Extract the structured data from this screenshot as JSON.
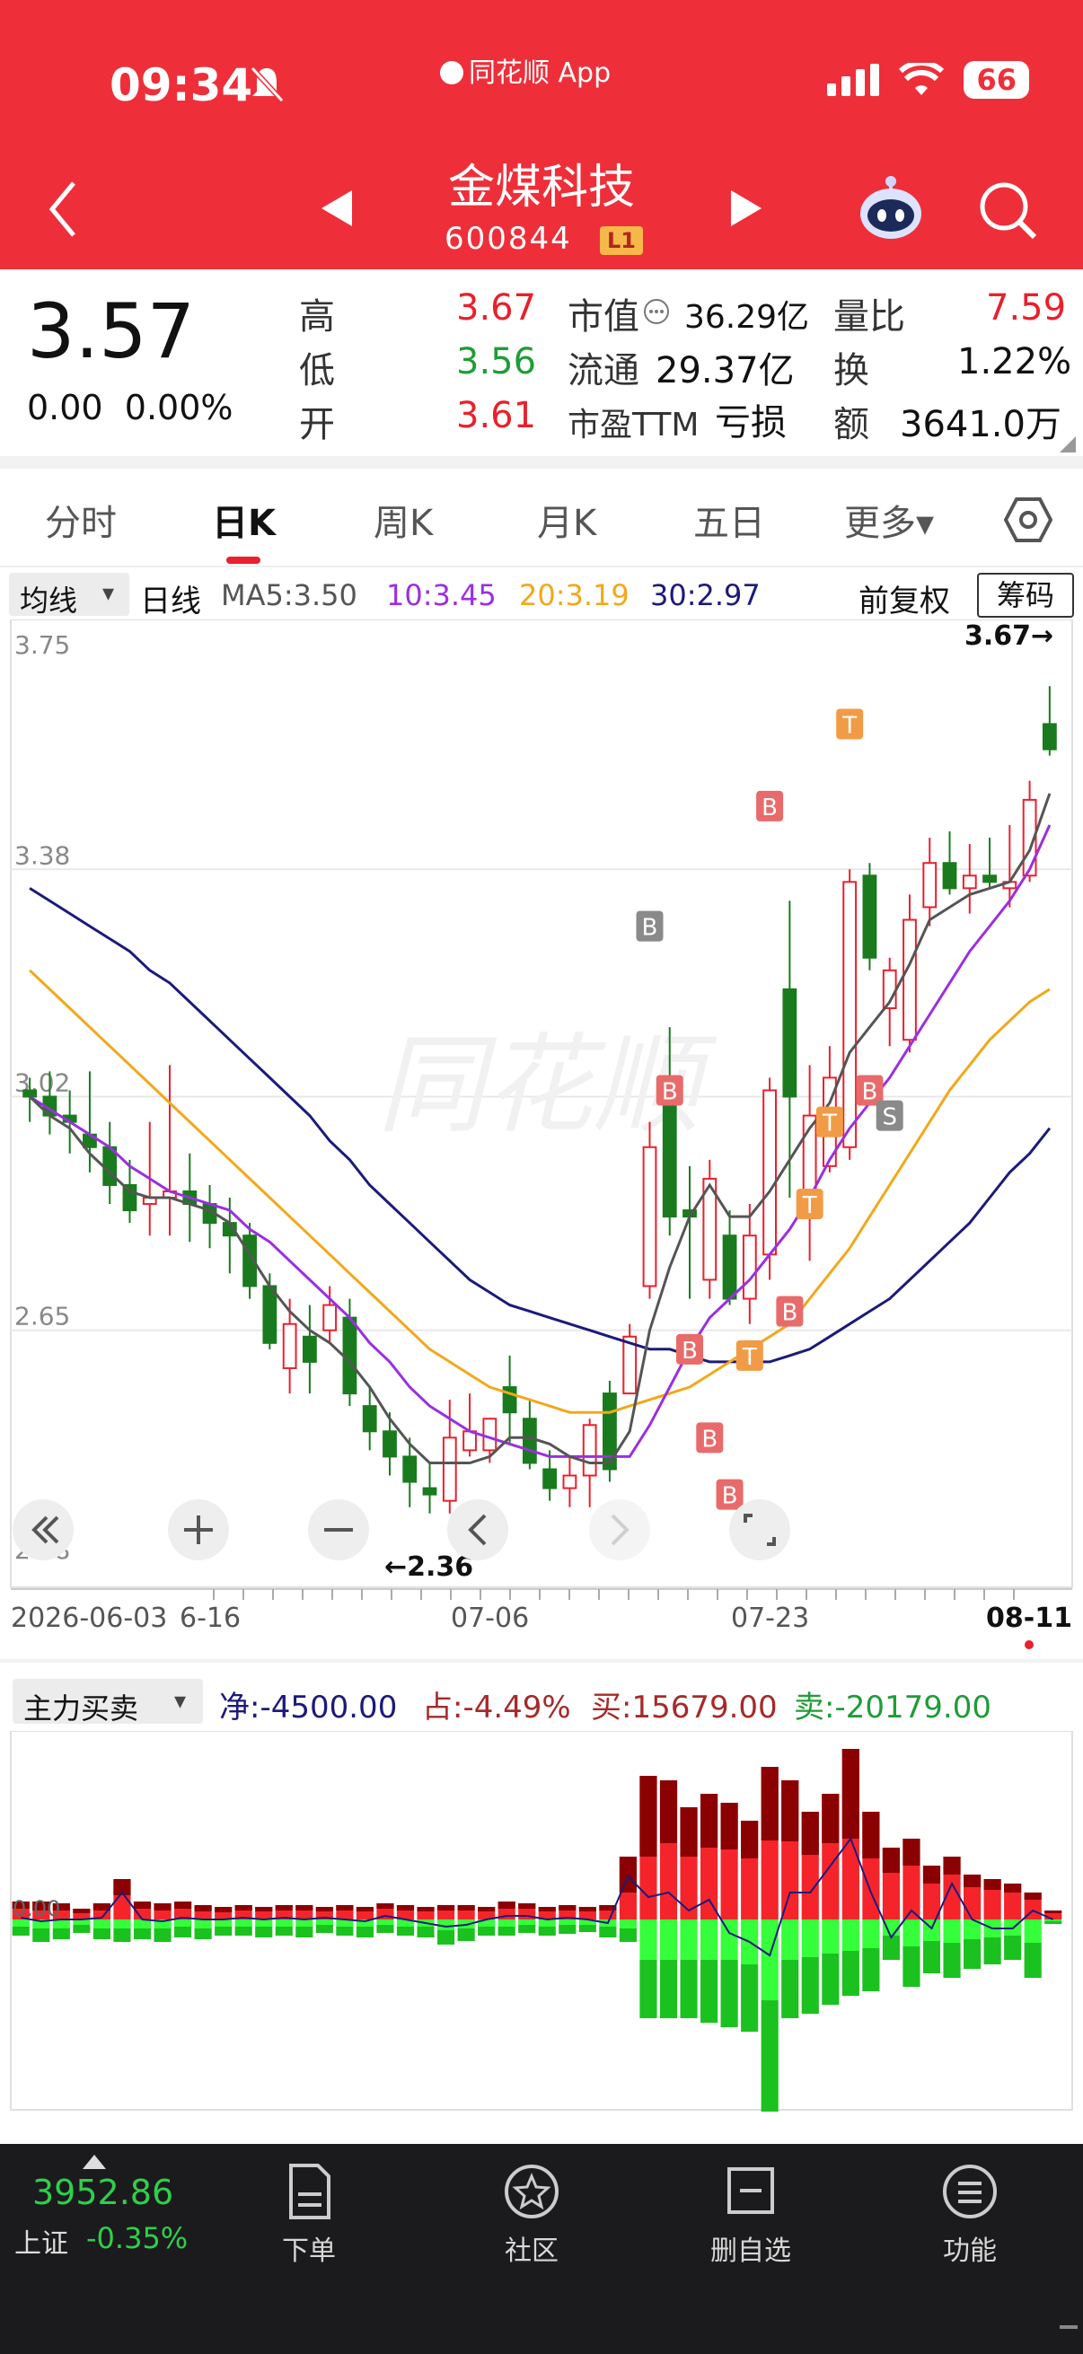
{
  "status_bar": {
    "time": "09:34",
    "app_label": "同花顺 App",
    "battery": "66"
  },
  "nav": {
    "title": "金煤科技",
    "code": "600844",
    "level_badge": "L1"
  },
  "quote": {
    "price": "3.57",
    "change": "0.00",
    "change_pct": "0.00%",
    "high_label": "高",
    "high": "3.67",
    "low_label": "低",
    "low": "3.56",
    "open_label": "开",
    "open": "3.61",
    "mcap_label": "市值",
    "mcap": "36.29亿",
    "float_label": "流通",
    "float": "29.37亿",
    "pe_label": "市盈TTM",
    "pe": "亏损",
    "vol_ratio_label": "量比",
    "vol_ratio": "7.59",
    "turnover_label": "换",
    "turnover": "1.22%",
    "amount_label": "额",
    "amount": "3641.0万"
  },
  "tabs": [
    "分时",
    "日K",
    "周K",
    "月K",
    "五日",
    "更多▾"
  ],
  "active_tab": "日K",
  "indicator_bar": {
    "selector": "均线",
    "period": "日线",
    "ma5": "MA5:3.50",
    "ma10": "10:3.45",
    "ma20": "20:3.19",
    "ma30": "30:2.97",
    "adjust": "前复权",
    "chips": "筹码"
  },
  "colors": {
    "header": "#ee2f3a",
    "up": "#e9202d",
    "down": "#1a7a1e",
    "ma5": "#555555",
    "ma10": "#9b2fe0",
    "ma20": "#f2a81b",
    "ma30": "#1c1a7a"
  },
  "chart_data": [
    {
      "type": "candlestick",
      "y_axis_labels": [
        "3.75",
        "3.38",
        "3.02",
        "2.65",
        "2.28"
      ],
      "ylim": [
        2.28,
        3.75
      ],
      "x_axis_labels": [
        "2026-06-03",
        "6-16",
        "07-06",
        "07-23",
        "08-11"
      ],
      "high_marker": "3.67→",
      "low_marker": "←2.36",
      "candles": [
        {
          "o": 3.03,
          "h": 3.05,
          "l": 2.98,
          "c": 3.02
        },
        {
          "o": 3.02,
          "h": 3.06,
          "l": 2.96,
          "c": 2.99
        },
        {
          "o": 2.99,
          "h": 3.03,
          "l": 2.93,
          "c": 2.98
        },
        {
          "o": 2.96,
          "h": 3.06,
          "l": 2.9,
          "c": 2.94
        },
        {
          "o": 2.94,
          "h": 2.98,
          "l": 2.85,
          "c": 2.88
        },
        {
          "o": 2.88,
          "h": 2.92,
          "l": 2.82,
          "c": 2.84
        },
        {
          "o": 2.85,
          "h": 2.98,
          "l": 2.8,
          "c": 2.86
        },
        {
          "o": 2.86,
          "h": 3.07,
          "l": 2.8,
          "c": 2.87
        },
        {
          "o": 2.87,
          "h": 2.93,
          "l": 2.79,
          "c": 2.85
        },
        {
          "o": 2.85,
          "h": 2.88,
          "l": 2.78,
          "c": 2.82
        },
        {
          "o": 2.82,
          "h": 2.86,
          "l": 2.74,
          "c": 2.8
        },
        {
          "o": 2.8,
          "h": 2.82,
          "l": 2.7,
          "c": 2.72
        },
        {
          "o": 2.72,
          "h": 2.74,
          "l": 2.62,
          "c": 2.63
        },
        {
          "o": 2.59,
          "h": 2.7,
          "l": 2.55,
          "c": 2.66
        },
        {
          "o": 2.64,
          "h": 2.69,
          "l": 2.55,
          "c": 2.6
        },
        {
          "o": 2.65,
          "h": 2.72,
          "l": 2.63,
          "c": 2.69
        },
        {
          "o": 2.67,
          "h": 2.7,
          "l": 2.53,
          "c": 2.55
        },
        {
          "o": 2.53,
          "h": 2.56,
          "l": 2.46,
          "c": 2.49
        },
        {
          "o": 2.49,
          "h": 2.52,
          "l": 2.42,
          "c": 2.45
        },
        {
          "o": 2.45,
          "h": 2.48,
          "l": 2.37,
          "c": 2.41
        },
        {
          "o": 2.4,
          "h": 2.44,
          "l": 2.36,
          "c": 2.39
        },
        {
          "o": 2.38,
          "h": 2.54,
          "l": 2.36,
          "c": 2.48
        },
        {
          "o": 2.46,
          "h": 2.55,
          "l": 2.45,
          "c": 2.49
        },
        {
          "o": 2.46,
          "h": 2.51,
          "l": 2.44,
          "c": 2.51
        },
        {
          "o": 2.56,
          "h": 2.61,
          "l": 2.47,
          "c": 2.52
        },
        {
          "o": 2.51,
          "h": 2.54,
          "l": 2.43,
          "c": 2.44
        },
        {
          "o": 2.43,
          "h": 2.46,
          "l": 2.38,
          "c": 2.4
        },
        {
          "o": 2.4,
          "h": 2.45,
          "l": 2.37,
          "c": 2.42
        },
        {
          "o": 2.42,
          "h": 2.51,
          "l": 2.37,
          "c": 2.5
        },
        {
          "o": 2.55,
          "h": 2.57,
          "l": 2.41,
          "c": 2.43
        },
        {
          "o": 2.55,
          "h": 2.66,
          "l": 2.55,
          "c": 2.64
        },
        {
          "o": 2.72,
          "h": 2.98,
          "l": 2.7,
          "c": 2.94
        },
        {
          "o": 3.05,
          "h": 3.13,
          "l": 2.8,
          "c": 2.83
        },
        {
          "o": 2.84,
          "h": 2.91,
          "l": 2.7,
          "c": 2.83
        },
        {
          "o": 2.73,
          "h": 2.92,
          "l": 2.7,
          "c": 2.89
        },
        {
          "o": 2.8,
          "h": 2.84,
          "l": 2.69,
          "c": 2.7
        },
        {
          "o": 2.7,
          "h": 2.85,
          "l": 2.66,
          "c": 2.8
        },
        {
          "o": 2.77,
          "h": 3.05,
          "l": 2.73,
          "c": 3.03
        },
        {
          "o": 3.19,
          "h": 3.33,
          "l": 2.86,
          "c": 3.02
        },
        {
          "o": 2.84,
          "h": 3.07,
          "l": 2.76,
          "c": 2.99
        },
        {
          "o": 2.91,
          "h": 3.1,
          "l": 2.9,
          "c": 3.05
        },
        {
          "o": 2.94,
          "h": 3.38,
          "l": 2.92,
          "c": 3.36
        },
        {
          "o": 3.37,
          "h": 3.39,
          "l": 3.22,
          "c": 3.24
        },
        {
          "o": 3.16,
          "h": 3.24,
          "l": 3.1,
          "c": 3.22
        },
        {
          "o": 3.11,
          "h": 3.34,
          "l": 3.09,
          "c": 3.3
        },
        {
          "o": 3.32,
          "h": 3.43,
          "l": 3.29,
          "c": 3.39
        },
        {
          "o": 3.39,
          "h": 3.44,
          "l": 3.34,
          "c": 3.35
        },
        {
          "o": 3.35,
          "h": 3.42,
          "l": 3.31,
          "c": 3.37
        },
        {
          "o": 3.37,
          "h": 3.43,
          "l": 3.35,
          "c": 3.36
        },
        {
          "o": 3.35,
          "h": 3.45,
          "l": 3.32,
          "c": 3.36
        },
        {
          "o": 3.37,
          "h": 3.52,
          "l": 3.36,
          "c": 3.49
        },
        {
          "o": 3.61,
          "h": 3.67,
          "l": 3.56,
          "c": 3.57
        }
      ],
      "ma5": [
        3.02,
        2.99,
        2.97,
        2.93,
        2.9,
        2.87,
        2.86,
        2.86,
        2.85,
        2.84,
        2.82,
        2.77,
        2.72,
        2.68,
        2.65,
        2.63,
        2.6,
        2.56,
        2.51,
        2.47,
        2.44,
        2.44,
        2.44,
        2.45,
        2.48,
        2.48,
        2.47,
        2.45,
        2.44,
        2.44,
        2.49,
        2.65,
        2.75,
        2.83,
        2.88,
        2.83,
        2.83,
        2.87,
        2.92,
        2.97,
        3.01,
        3.09,
        3.13,
        3.17,
        3.23,
        3.3,
        3.32,
        3.34,
        3.35,
        3.36,
        3.41,
        3.5
      ],
      "ma10": [
        3.02,
        3.0,
        2.98,
        2.96,
        2.94,
        2.91,
        2.89,
        2.87,
        2.86,
        2.85,
        2.84,
        2.81,
        2.79,
        2.76,
        2.73,
        2.7,
        2.67,
        2.63,
        2.6,
        2.56,
        2.53,
        2.51,
        2.49,
        2.48,
        2.47,
        2.46,
        2.45,
        2.45,
        2.45,
        2.45,
        2.45,
        2.5,
        2.56,
        2.62,
        2.67,
        2.7,
        2.73,
        2.77,
        2.81,
        2.86,
        2.92,
        2.97,
        3.01,
        3.05,
        3.1,
        3.15,
        3.2,
        3.25,
        3.29,
        3.33,
        3.38,
        3.45
      ],
      "ma20": [
        3.22,
        3.19,
        3.16,
        3.13,
        3.1,
        3.07,
        3.04,
        3.01,
        2.98,
        2.95,
        2.92,
        2.89,
        2.86,
        2.83,
        2.8,
        2.77,
        2.74,
        2.71,
        2.68,
        2.65,
        2.62,
        2.6,
        2.58,
        2.56,
        2.55,
        2.54,
        2.53,
        2.52,
        2.52,
        2.52,
        2.53,
        2.54,
        2.55,
        2.56,
        2.58,
        2.6,
        2.62,
        2.64,
        2.66,
        2.7,
        2.74,
        2.78,
        2.83,
        2.88,
        2.93,
        2.98,
        3.03,
        3.07,
        3.11,
        3.14,
        3.17,
        3.19
      ],
      "ma30": [
        3.35,
        3.33,
        3.31,
        3.29,
        3.27,
        3.25,
        3.22,
        3.2,
        3.17,
        3.14,
        3.11,
        3.08,
        3.05,
        3.02,
        2.99,
        2.95,
        2.92,
        2.88,
        2.85,
        2.82,
        2.79,
        2.76,
        2.73,
        2.71,
        2.69,
        2.68,
        2.67,
        2.66,
        2.65,
        2.64,
        2.63,
        2.62,
        2.62,
        2.61,
        2.6,
        2.6,
        2.6,
        2.6,
        2.61,
        2.62,
        2.64,
        2.66,
        2.68,
        2.7,
        2.73,
        2.76,
        2.79,
        2.82,
        2.86,
        2.9,
        2.93,
        2.97
      ],
      "signals": [
        {
          "label": "B",
          "i": 31,
          "price": 3.29,
          "color": "#8a8a8a"
        },
        {
          "label": "B",
          "i": 32,
          "price": 3.03,
          "color": "#e96a6a"
        },
        {
          "label": "B",
          "i": 33,
          "price": 2.62,
          "color": "#e96a6a"
        },
        {
          "label": "B",
          "i": 34,
          "price": 2.48,
          "color": "#e96a6a"
        },
        {
          "label": "B",
          "i": 35,
          "price": 2.39,
          "color": "#e96a6a"
        },
        {
          "label": "T",
          "i": 36,
          "price": 2.61,
          "color": "#f29b47"
        },
        {
          "label": "B",
          "i": 37,
          "price": 3.48,
          "color": "#e96a6a"
        },
        {
          "label": "B",
          "i": 38,
          "price": 2.68,
          "color": "#e96a6a"
        },
        {
          "label": "T",
          "i": 39,
          "price": 2.85,
          "color": "#f29b47"
        },
        {
          "label": "T",
          "i": 40,
          "price": 2.98,
          "color": "#f29b47"
        },
        {
          "label": "T",
          "i": 41,
          "price": 3.61,
          "color": "#f29b47"
        },
        {
          "label": "B",
          "i": 42,
          "price": 3.03,
          "color": "#e96a6a"
        },
        {
          "label": "S",
          "i": 43,
          "price": 2.99,
          "color": "#8a8a8a"
        }
      ]
    },
    {
      "type": "bar",
      "title": "主力买卖",
      "net_label": "净:-4500.00",
      "share_label": "占:-4.49%",
      "buy_label": "买:15679.00",
      "sell_label": "卖:-20179.00",
      "zero_label": "0.00",
      "buy": [
        20,
        20,
        18,
        12,
        18,
        45,
        20,
        18,
        20,
        16,
        14,
        16,
        14,
        16,
        16,
        14,
        16,
        14,
        18,
        16,
        14,
        16,
        16,
        14,
        20,
        18,
        14,
        16,
        14,
        16,
        70,
        160,
        155,
        125,
        140,
        130,
        110,
        170,
        155,
        120,
        140,
        190,
        120,
        80,
        90,
        60,
        70,
        50,
        45,
        40,
        30,
        10
      ],
      "buy_dark": [
        8,
        10,
        8,
        5,
        8,
        18,
        8,
        8,
        8,
        7,
        6,
        6,
        5,
        6,
        6,
        5,
        6,
        5,
        6,
        6,
        5,
        6,
        6,
        5,
        8,
        6,
        5,
        6,
        5,
        6,
        40,
        90,
        70,
        55,
        60,
        52,
        42,
        82,
        68,
        48,
        55,
        100,
        52,
        28,
        30,
        20,
        20,
        14,
        12,
        10,
        8,
        3
      ],
      "sell": [
        18,
        25,
        22,
        15,
        22,
        25,
        22,
        25,
        20,
        22,
        18,
        18,
        20,
        18,
        20,
        15,
        18,
        20,
        15,
        18,
        20,
        28,
        24,
        18,
        18,
        15,
        18,
        16,
        14,
        20,
        25,
        110,
        110,
        110,
        115,
        120,
        125,
        215,
        110,
        105,
        95,
        85,
        80,
        45,
        75,
        60,
        65,
        55,
        50,
        45,
        65,
        5
      ],
      "sell_light": [
        8,
        10,
        10,
        6,
        10,
        10,
        10,
        10,
        8,
        10,
        8,
        8,
        8,
        8,
        8,
        6,
        8,
        8,
        6,
        8,
        8,
        12,
        10,
        8,
        8,
        6,
        8,
        6,
        6,
        8,
        10,
        45,
        45,
        45,
        45,
        45,
        50,
        90,
        45,
        42,
        38,
        35,
        32,
        18,
        30,
        24,
        26,
        22,
        20,
        18,
        26,
        2
      ],
      "net_line": [
        2,
        -2,
        0,
        0,
        2,
        30,
        0,
        -2,
        2,
        0,
        0,
        2,
        0,
        2,
        0,
        2,
        0,
        -2,
        4,
        0,
        -4,
        -8,
        -6,
        0,
        4,
        4,
        0,
        2,
        0,
        -4,
        48,
        25,
        30,
        10,
        22,
        -15,
        -25,
        -40,
        30,
        30,
        60,
        90,
        30,
        -20,
        10,
        -10,
        40,
        0,
        -10,
        -10,
        10,
        0
      ]
    }
  ],
  "bottom_bar": {
    "index_value": "3952.86",
    "index_name": "上证",
    "index_change": "-0.35%",
    "items": [
      {
        "label": "下单",
        "icon": "order-doc-icon"
      },
      {
        "label": "社区",
        "icon": "community-star-icon"
      },
      {
        "label": "删自选",
        "icon": "remove-watchlist-icon"
      },
      {
        "label": "功能",
        "icon": "menu-circle-icon"
      }
    ]
  }
}
